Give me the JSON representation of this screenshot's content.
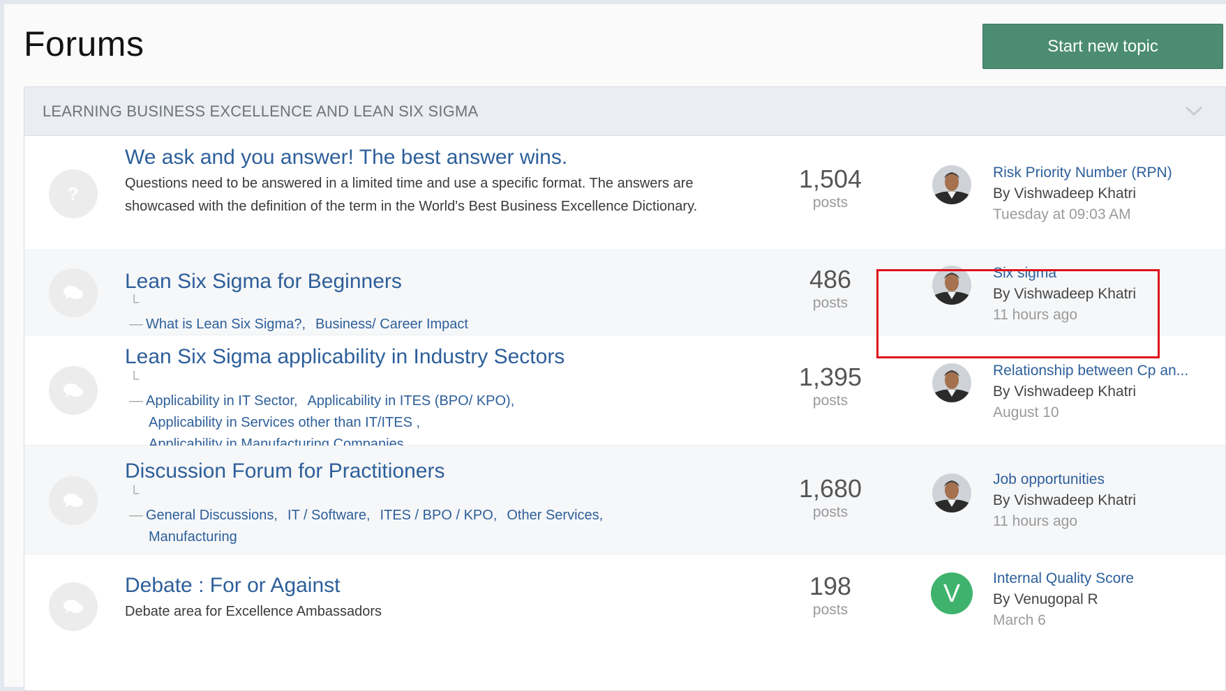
{
  "page": {
    "title": "Forums"
  },
  "actions": {
    "start_topic": "Start new topic"
  },
  "section": {
    "title": "LEARNING BUSINESS EXCELLENCE AND LEAN SIX SIGMA"
  },
  "forums": [
    {
      "title": "We ask and you answer! The best answer wins.",
      "description": "Questions need to be answered in a limited time and use a specific format. The answers are showcased with the definition of the term in the World's Best Business Excellence Dictionary.",
      "icon": "question-icon",
      "posts": "1,504",
      "posts_label": "posts",
      "last_post": {
        "title": "Risk Priority Number (RPN)",
        "by": "By",
        "author": "Vishwadeep Khatri",
        "time": "Tuesday at 09:03 AM"
      }
    },
    {
      "title": "Lean Six Sigma for Beginners",
      "icon": "chat-bubbles-icon",
      "subforums": [
        "What is Lean Six Sigma?,",
        "Business/ Career Impact"
      ],
      "posts": "486",
      "posts_label": "posts",
      "last_post": {
        "title": "Six sigma",
        "by": "By",
        "author": "Vishwadeep Khatri",
        "time": "11 hours ago"
      }
    },
    {
      "title": "Lean Six Sigma applicability in Industry Sectors",
      "icon": "chat-bubbles-icon",
      "subforums": [
        "Applicability in IT Sector,",
        "Applicability in ITES (BPO/ KPO),",
        "Applicability in Services other than IT/ITES ,",
        "Applicability in Manufacturing Companies"
      ],
      "posts": "1,395",
      "posts_label": "posts",
      "last_post": {
        "title": "Relationship between Cp an...",
        "by": "By",
        "author": "Vishwadeep Khatri",
        "time": "August 10"
      }
    },
    {
      "title": "Discussion Forum for Practitioners",
      "icon": "chat-bubbles-icon",
      "subforums": [
        "General Discussions,",
        "IT / Software,",
        "ITES / BPO / KPO,",
        "Other Services,",
        "Manufacturing"
      ],
      "posts": "1,680",
      "posts_label": "posts",
      "last_post": {
        "title": "Job opportunities",
        "by": "By",
        "author": "Vishwadeep Khatri",
        "time": "11 hours ago"
      }
    },
    {
      "title": "Debate : For or Against",
      "description": "Debate area for Excellence Ambassadors",
      "icon": "chat-bubbles-icon",
      "posts": "198",
      "posts_label": "posts",
      "last_post": {
        "title": "Internal Quality Score",
        "by": "By",
        "author": "Venugopal R",
        "time": "March 6",
        "avatar_letter": "V"
      }
    }
  ],
  "colors": {
    "accent_button": "#4b8c72",
    "link": "#2d5f9a",
    "highlight_box": "#e0101a",
    "avatar_letter_bg": "#3fb36d"
  }
}
